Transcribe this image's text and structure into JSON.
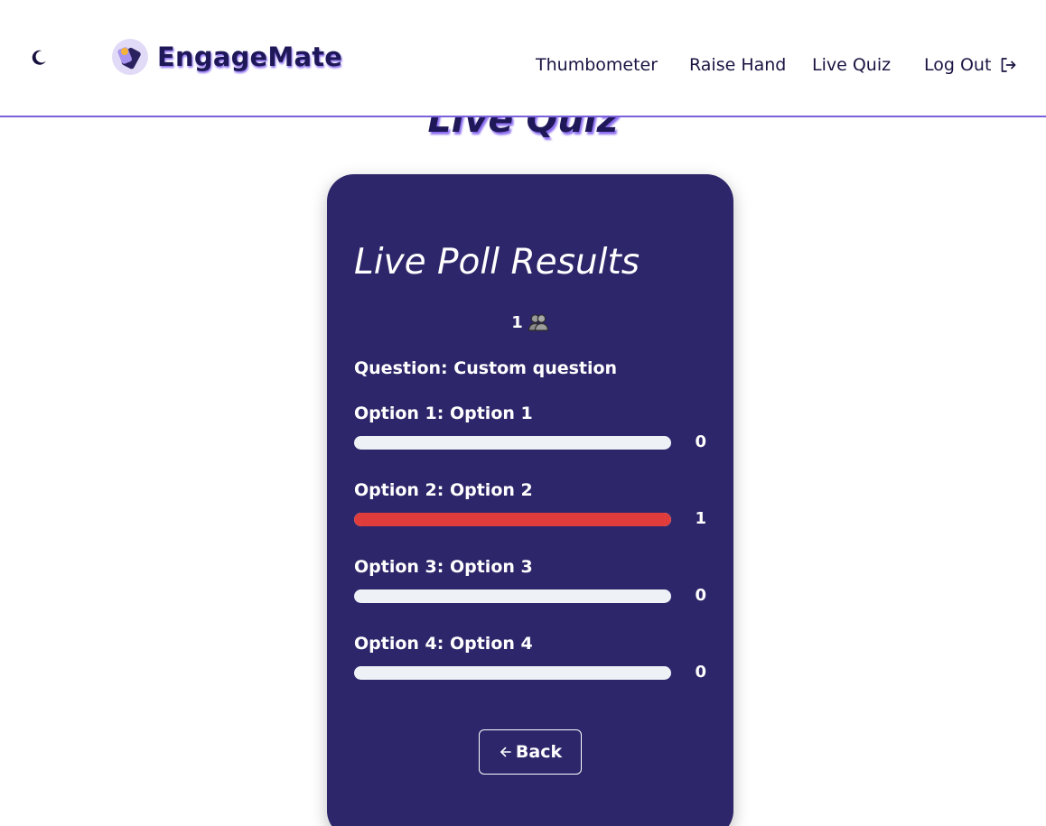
{
  "navbar": {
    "theme_toggle_icon": "moon-icon",
    "brand_name": "EngageMate",
    "links": [
      "Thumbometer",
      "Raise Hand",
      "Live Quiz"
    ],
    "logout_label": "Log Out",
    "logout_icon": "logout-icon",
    "accent_color": "#7b61dc"
  },
  "page": {
    "heading": "Live Quiz"
  },
  "results": {
    "title": "Live Poll Results",
    "participant_count": "1",
    "participant_icon": "people-icon",
    "question": "Question: Custom question",
    "options": [
      {
        "label": "Option 1: Option 1",
        "count": "0",
        "fraction": 0
      },
      {
        "label": "Option 2: Option 2",
        "count": "1",
        "fraction": 1
      },
      {
        "label": "Option 3: Option 3",
        "count": "0",
        "fraction": 0
      },
      {
        "label": "Option 4: Option 4",
        "count": "0",
        "fraction": 0
      }
    ],
    "back_label": "Back",
    "colors": {
      "card": "#2d266a",
      "bar_track": "#eef1f6",
      "bar_fill": "#e03c3c"
    }
  }
}
